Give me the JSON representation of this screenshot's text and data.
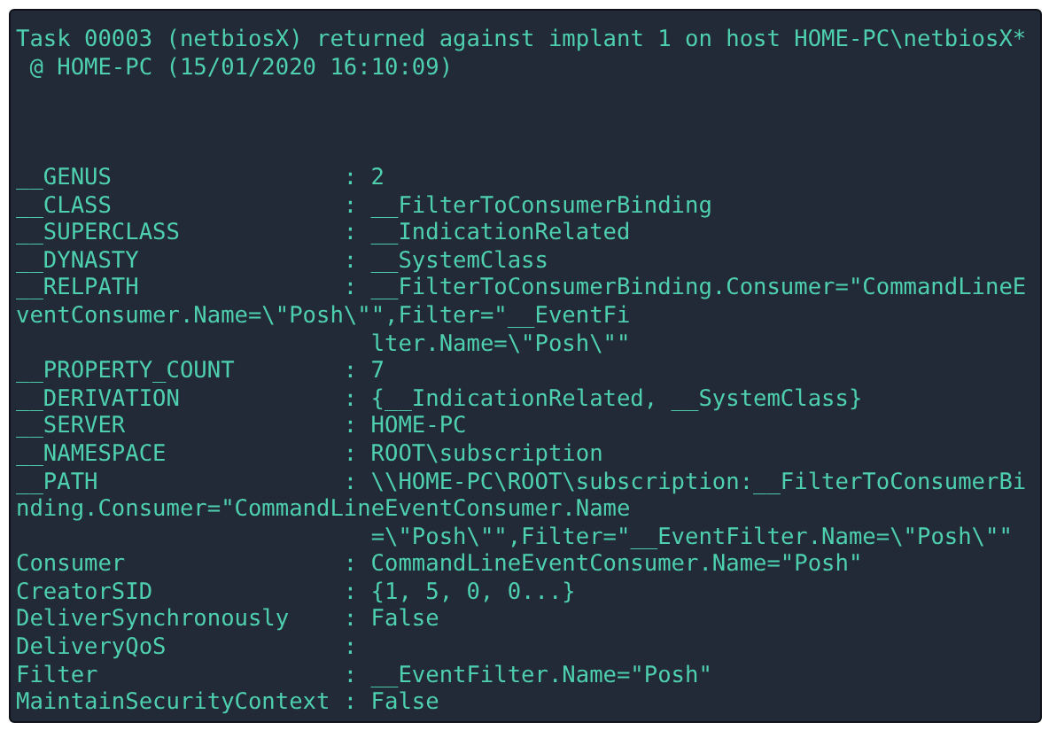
{
  "header": [
    "Task 00003 (netbiosX) returned against implant 1 on host HOME-PC\\netbiosX*",
    " @ HOME-PC (15/01/2020 16:10:09)"
  ],
  "properties": [
    {
      "name": "__GENUS",
      "separator": ":",
      "value": "2"
    },
    {
      "name": "__CLASS",
      "separator": ":",
      "value": "__FilterToConsumerBinding"
    },
    {
      "name": "__SUPERCLASS",
      "separator": ":",
      "value": "__IndicationRelated"
    },
    {
      "name": "__DYNASTY",
      "separator": ":",
      "value": "__SystemClass"
    },
    {
      "name": "__RELPATH",
      "separator": ":",
      "value": "__FilterToConsumerBinding.Consumer=\"CommandLineE",
      "continuation": [
        {
          "kind": "wrap",
          "text": "ventConsumer.Name=\\\"Posh\\\"\",Filter=\"__EventFi"
        },
        {
          "kind": "indent",
          "text": "lter.Name=\\\"Posh\\\"\""
        }
      ]
    },
    {
      "name": "__PROPERTY_COUNT",
      "separator": ":",
      "value": "7"
    },
    {
      "name": "__DERIVATION",
      "separator": ":",
      "value": "{__IndicationRelated, __SystemClass}"
    },
    {
      "name": "__SERVER",
      "separator": ":",
      "value": "HOME-PC"
    },
    {
      "name": "__NAMESPACE",
      "separator": ":",
      "value": "ROOT\\subscription"
    },
    {
      "name": "__PATH",
      "separator": ":",
      "value": "\\\\HOME-PC\\ROOT\\subscription:__FilterToConsumerBi",
      "continuation": [
        {
          "kind": "wrap",
          "text": "nding.Consumer=\"CommandLineEventConsumer.Name"
        },
        {
          "kind": "indent",
          "text": "=\\\"Posh\\\"\",Filter=\"__EventFilter.Name=\\\"Posh\\\"\""
        }
      ]
    },
    {
      "name": "Consumer",
      "separator": ":",
      "value": "CommandLineEventConsumer.Name=\"Posh\""
    },
    {
      "name": "CreatorSID",
      "separator": ":",
      "value": "{1, 5, 0, 0...}"
    },
    {
      "name": "DeliverSynchronously",
      "separator": ":",
      "value": "False"
    },
    {
      "name": "DeliveryQoS",
      "separator": ":"
    },
    {
      "name": "Filter",
      "separator": ":",
      "value": "__EventFilter.Name=\"Posh\""
    },
    {
      "name": "MaintainSecurityContext",
      "separator": ":",
      "value": "False"
    }
  ]
}
